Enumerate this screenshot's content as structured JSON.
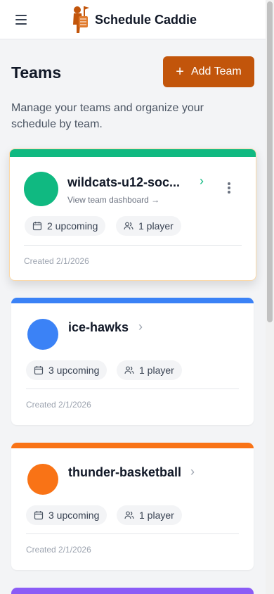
{
  "header": {
    "app_title": "Schedule Caddie",
    "menu_icon": "hamburger-icon",
    "logo_icon": "caddie-logo-icon"
  },
  "page": {
    "title": "Teams",
    "add_button_label": "Add Team",
    "add_button_icon": "plus-icon",
    "subtitle": "Manage your teams and organize your schedule by team."
  },
  "colors": {
    "accent": "#c2550b"
  },
  "teams": [
    {
      "name": "wildcats-u12-soc...",
      "dashboard_link": "View team dashboard →",
      "upcoming": "2 upcoming",
      "players": "1 player",
      "created": "Created 2/1/2026",
      "color": "#10b981"
    },
    {
      "name": "ice-hawks",
      "upcoming": "3 upcoming",
      "players": "1 player",
      "created": "Created 2/1/2026",
      "color": "#3b82f6"
    },
    {
      "name": "thunder-basketball",
      "upcoming": "3 upcoming",
      "players": "1 player",
      "created": "Created 2/1/2026",
      "color": "#f97316"
    },
    {
      "color": "#8b5cf6"
    }
  ]
}
